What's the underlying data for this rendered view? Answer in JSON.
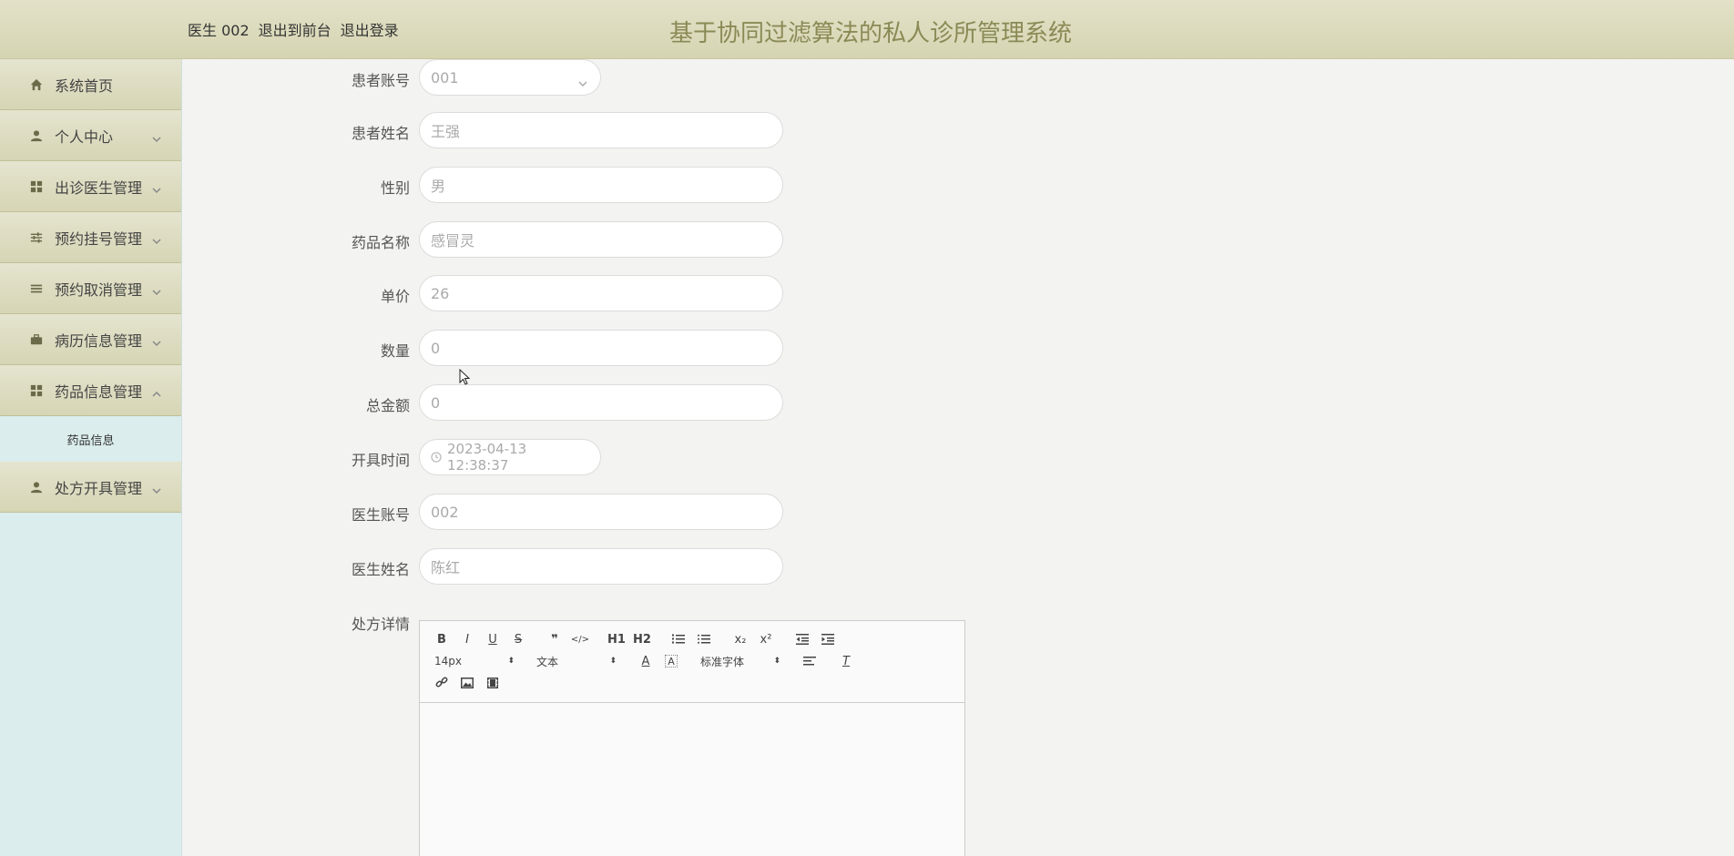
{
  "header": {
    "links": [
      "医生 002",
      "退出到前台",
      "退出登录"
    ],
    "title": "基于协同过滤算法的私人诊所管理系统"
  },
  "sidebar": {
    "items": [
      {
        "label": "系统首页",
        "icon": "home-icon"
      },
      {
        "label": "个人中心",
        "icon": "user-icon"
      },
      {
        "label": "出诊医生管理",
        "icon": "grid-icon"
      },
      {
        "label": "预约挂号管理",
        "icon": "sliders-icon"
      },
      {
        "label": "预约取消管理",
        "icon": "list-icon"
      },
      {
        "label": "病历信息管理",
        "icon": "briefcase-icon"
      },
      {
        "label": "药品信息管理",
        "icon": "grid-icon"
      },
      {
        "label": "处方开具管理",
        "icon": "user-icon"
      }
    ],
    "submenu": {
      "label": "药品信息"
    }
  },
  "form": {
    "patient_account": {
      "label": "患者账号",
      "value": "001"
    },
    "patient_name": {
      "label": "患者姓名",
      "value": "王强"
    },
    "gender": {
      "label": "性别",
      "value": "男"
    },
    "drug_name": {
      "label": "药品名称",
      "value": "感冒灵"
    },
    "unit_price": {
      "label": "单价",
      "value": "26"
    },
    "quantity": {
      "label": "数量",
      "value": "0"
    },
    "total_amount": {
      "label": "总金额",
      "value": "0"
    },
    "issue_time": {
      "label": "开具时间",
      "value": "2023-04-13 12:38:37"
    },
    "doctor_account": {
      "label": "医生账号",
      "value": "002"
    },
    "doctor_name": {
      "label": "医生姓名",
      "value": "陈红"
    },
    "prescription_detail": {
      "label": "处方详情"
    }
  },
  "editor": {
    "font_size": "14px",
    "text_type": "文本",
    "font_family": "标准字体",
    "buttons": {
      "h1": "H1",
      "h2": "H2",
      "sub": "x₂",
      "sup": "x²"
    }
  },
  "colors": {
    "header_bg": "#d5d4b1",
    "title_color": "#8a8a56",
    "sidebar_bg": "#dbeded"
  }
}
